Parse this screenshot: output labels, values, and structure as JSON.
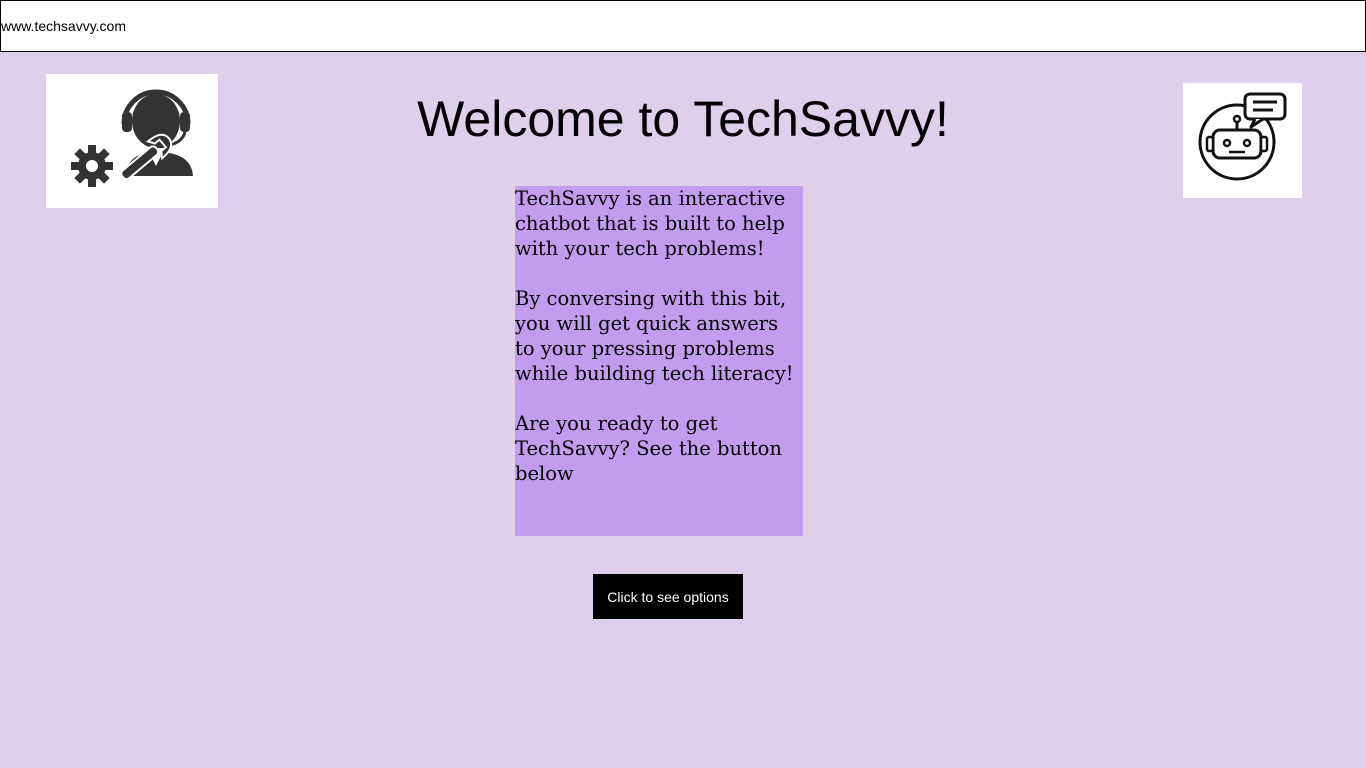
{
  "address_bar": {
    "url": "www.techsavvy.com"
  },
  "header": {
    "title": "Welcome to TechSavvy!"
  },
  "logos": {
    "left_icon": "tech-support-agent-icon",
    "right_icon": "chatbot-robot-icon"
  },
  "intro": {
    "paragraphs": [
      "TechSavvy is an interactive chatbot that is built to help with your tech problems!",
      "By conversing with this bit, you will get quick answers to your pressing problems while building tech literacy!",
      "Are you ready to get TechSavvy? See the button below"
    ]
  },
  "cta": {
    "label": "Click to see options"
  },
  "colors": {
    "page_background": "#decfea",
    "intro_background": "#c29ded",
    "button_background": "#000000",
    "button_text": "#ffffff"
  }
}
